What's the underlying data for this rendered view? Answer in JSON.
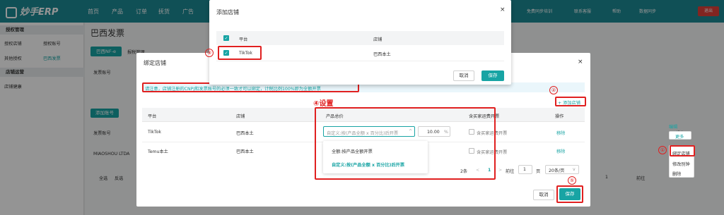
{
  "app": {
    "logo": "妙手ERP",
    "nav": [
      "首页",
      "产品",
      "订单",
      "抚货",
      "广告"
    ],
    "top_right": [
      "免费同步培训",
      "联系客服",
      "帮助",
      "数据同步"
    ],
    "quit": "退出"
  },
  "sidebar": {
    "section1": "授权管理",
    "items1": [
      "授权店铺",
      "授权账号",
      "其他授权",
      "巴西发票"
    ],
    "section2": "店铺运营",
    "items2": [
      "店铺健康"
    ]
  },
  "page": {
    "title": "巴西发票",
    "tab1": "巴西NF-e",
    "tab2": "报税管理",
    "filter_label": "发票账号",
    "add_account": "添加账号",
    "col_account": "发票账号",
    "row_account": "MIAOSHOU LTDA",
    "select_all": "全选",
    "invert": "反选",
    "col_actions": "操作",
    "edit_link": "编辑",
    "more_btn": "更多",
    "menu": [
      "绑定店铺",
      "修改别钟",
      "删除"
    ],
    "page_num": "1",
    "page_goto": "前往"
  },
  "dialog1": {
    "title": "添加店铺",
    "col_platform": "平台",
    "col_store": "店铺",
    "row_platform": "TikTok",
    "row_store": "巴西本土",
    "cancel": "取消",
    "save": "保存"
  },
  "dialog2": {
    "title": "绑定店铺",
    "notice": "请注意，店铺注册的CNPJ和发票账号的必须一致才可以绑定，计税比例100%即为全额开票",
    "add_store": "+ 添加店铺",
    "headers": {
      "platform": "平台",
      "store": "店铺",
      "price": "产品总价",
      "shipping": "含买家运费开票",
      "action": "操作"
    },
    "rows": [
      {
        "platform": "TikTok",
        "store": "巴西本土",
        "price_select": "自定义:按(产品全额 x 百分比)后开票",
        "percent": "10.00",
        "unit": "%",
        "shipping": "含买家运费开票",
        "action": "移除"
      },
      {
        "platform": "Temu本土",
        "store": "巴西本土",
        "shipping": "含买家运费开票",
        "action": "移除"
      }
    ],
    "dropdown": [
      "全额:按产品全额开票",
      "自定义:按(产品全额 x 百分比)后开票"
    ],
    "pagination": {
      "total": "2条",
      "page": "1",
      "goto_label": "前往",
      "goto_val": "1",
      "page_unit": "页",
      "per_page": "20条/页"
    },
    "cancel": "取消",
    "save": "保存"
  },
  "annotations": {
    "n1": "①",
    "n2": "②",
    "n3": "③",
    "n4": "④设置",
    "n5": "⑤"
  }
}
